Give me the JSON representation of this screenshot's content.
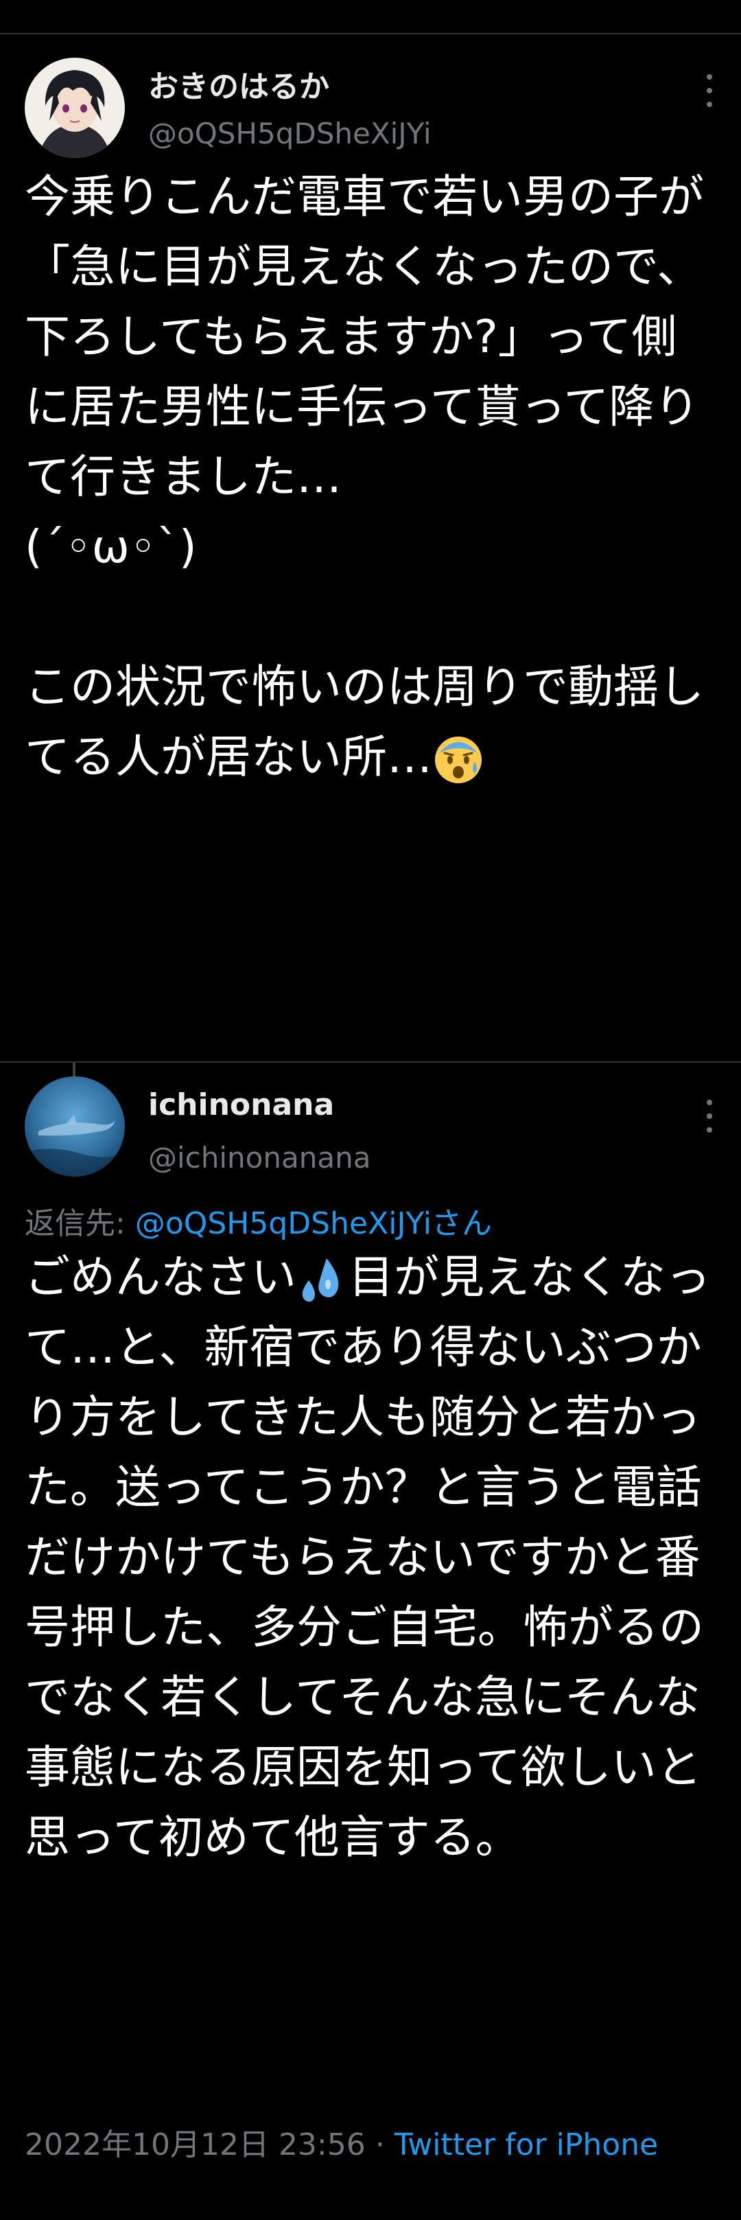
{
  "tweet1": {
    "display_name": "おきのはるか",
    "handle": "@oQSH5qDSheXiJYi",
    "text": "今乗りこんだ電車で若い男の子が\n「急に目が見えなくなったので、下ろしてもらえますか?」って側に居た男性に手伝って貰って降りて行きました…\n(´◦ω◦`)\n\nこの状況で怖いのは周りで動揺してる人が居ない所…",
    "trailing_emoji": "anxious-face-with-sweat-icon"
  },
  "tweet2": {
    "display_name": "ichinonana",
    "handle": "@ichinonanana",
    "reply_prefix": "返信先: ",
    "reply_mention": "@oQSH5qDSheXiJYiさん",
    "text_before_emoji": "ごめんなさい",
    "inline_emoji": "sweat-droplets-icon",
    "text_after_emoji": "目が見えなくなって…と、新宿であり得ないぶつかり方をしてきた人も随分と若かった。送ってこうか？と言うと電話だけかけてもらえないですかと番号押した、多分ご自宅。怖がるのでなく若くしてそんな急にそんな事態になる原因を知って欲しいと思って初めて他言する。",
    "timestamp": "2022年10月12日 23:56",
    "separator": " · ",
    "source": "Twitter for iPhone"
  },
  "colors": {
    "background": "#000000",
    "text": "#ffffff",
    "secondary": "#71767b",
    "link": "#1d9bf0",
    "divider": "#2f3336"
  }
}
